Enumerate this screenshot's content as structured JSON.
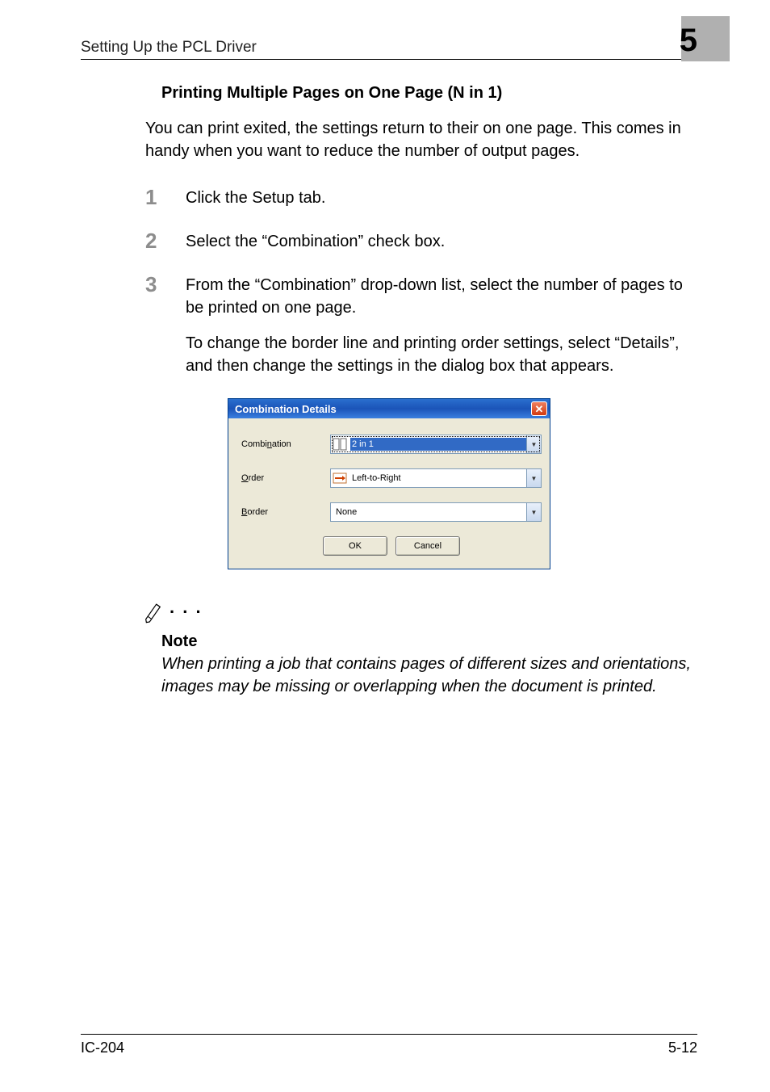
{
  "header": {
    "section_title": "Setting Up the PCL Driver",
    "chapter_number": "5"
  },
  "heading": "Printing Multiple Pages on One Page (N in 1)",
  "intro": "You can print exited, the settings return to their on one page. This comes in handy when you want to reduce the number of output pages.",
  "steps": {
    "n1": "1",
    "s1": "Click the Setup tab.",
    "n2": "2",
    "s2": "Select the “Combination” check box.",
    "n3": "3",
    "s3a": "From the “Combination” drop-down list, select the number of pages to be printed on one page.",
    "s3b": "To change the border line and printing order settings, select “Details”, and then change the settings in the dialog box that appears."
  },
  "dialog": {
    "title": "Combination Details",
    "combination_prefix": "Combi",
    "combination_u": "n",
    "combination_suffix": "ation",
    "combination_value": "2 in 1",
    "order_u": "O",
    "order_suffix": "rder",
    "order_value": "Left-to-Right",
    "border_u": "B",
    "border_suffix": "order",
    "border_value": "None",
    "ok": "OK",
    "cancel": "Cancel"
  },
  "note": {
    "dots": ". . .",
    "label": "Note",
    "text": "When printing a job that contains pages of different sizes and orientations, images may be missing or overlapping when the document is printed."
  },
  "footer": {
    "left": "IC-204",
    "right": "5-12"
  }
}
